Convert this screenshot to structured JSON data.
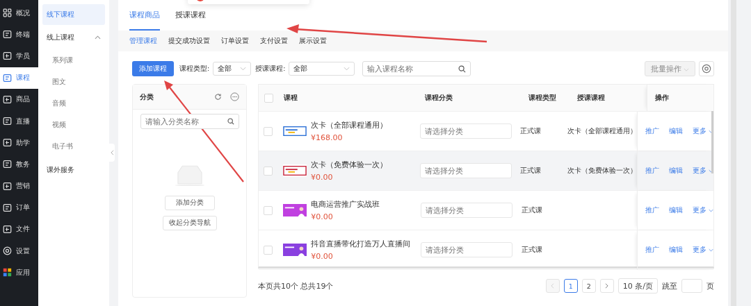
{
  "nav": [
    {
      "label": "概况",
      "selected": false
    },
    {
      "label": "终端",
      "selected": false
    },
    {
      "label": "学员",
      "selected": false
    },
    {
      "label": "课程",
      "selected": true
    },
    {
      "label": "商品",
      "selected": false
    },
    {
      "label": "直播",
      "selected": false
    },
    {
      "label": "助学",
      "selected": false
    },
    {
      "label": "教务",
      "selected": false
    },
    {
      "label": "营销",
      "selected": false
    },
    {
      "label": "订单",
      "selected": false
    },
    {
      "label": "文件",
      "selected": false
    },
    {
      "label": "设置",
      "selected": false
    },
    {
      "label": "应用",
      "selected": false
    }
  ],
  "subnav": [
    {
      "label": "线下课程",
      "selected": true
    },
    {
      "label": "线上课程",
      "selected": false,
      "expanded": true,
      "children": [
        {
          "label": "系列课",
          "selected": false
        },
        {
          "label": "图文",
          "selected": false
        },
        {
          "label": "音频",
          "selected": false
        },
        {
          "label": "视频",
          "selected": false
        },
        {
          "label": "电子书",
          "selected": false
        }
      ]
    },
    {
      "label": "课外服务",
      "selected": false
    }
  ],
  "tabs": [
    {
      "label": "课程商品",
      "selected": true
    },
    {
      "label": "授课课程",
      "selected": false
    }
  ],
  "subtabs": [
    {
      "label": "管理课程",
      "selected": true
    },
    {
      "label": "提交成功设置",
      "selected": false
    },
    {
      "label": "订单设置",
      "selected": false
    },
    {
      "label": "支付设置",
      "selected": false
    },
    {
      "label": "展示设置",
      "selected": false
    }
  ],
  "toolbar": {
    "add_button": "添加课程",
    "filters": [
      {
        "label": "课程类型:",
        "value": "全部"
      },
      {
        "label": "授课课程:",
        "value": "全部"
      }
    ],
    "search": {
      "placeholder": "输入课程名称"
    },
    "batch_button": {
      "label": "批量操作",
      "disabled": true
    }
  },
  "category_panel": {
    "title": "分类",
    "search": {
      "placeholder": "请输入分类名称"
    },
    "buttons": [
      "添加分类",
      "收起分类导航"
    ]
  },
  "table": {
    "all_checked": false,
    "columns": [
      "课程",
      "课程分类",
      "课程类型",
      "授课课程",
      "操作"
    ],
    "rows": [
      {
        "title": "次卡（全部课程通用）",
        "price": "¥168.00",
        "category_placeholder": "请选择分类",
        "type": "正式课",
        "teaching": "次卡（全部课程通用）",
        "actions": [
          "推广",
          "编辑",
          "更多"
        ],
        "highlighted": false,
        "checked": false
      },
      {
        "title": "次卡（免费体验一次）",
        "price": "¥0.00",
        "category_placeholder": "请选择分类",
        "type": "正式课",
        "teaching": "次卡（免费体验一次）",
        "actions": [
          "推广",
          "编辑",
          "更多"
        ],
        "highlighted": true,
        "checked": false
      },
      {
        "title": "电商运营推广实战班",
        "price": "¥0.00",
        "category_placeholder": "请选择分类",
        "type": "正式课",
        "actions": [
          "推广",
          "编辑",
          "更多"
        ],
        "highlighted": false,
        "checked": false
      },
      {
        "title": "抖音直播带化打造万人直播间",
        "price": "¥0.00",
        "category_placeholder": "请选择分类",
        "type": "正式课",
        "actions": [
          "推广",
          "编辑",
          "更多"
        ],
        "highlighted": false,
        "checked": false
      }
    ]
  },
  "footer": {
    "summary": "本页共10个 总共19个",
    "pages": [
      {
        "label": "1",
        "selected": true
      },
      {
        "label": "2",
        "selected": false
      }
    ],
    "page_size": "10 条/页",
    "jump_label": "跳至",
    "jump_suffix": "页"
  }
}
